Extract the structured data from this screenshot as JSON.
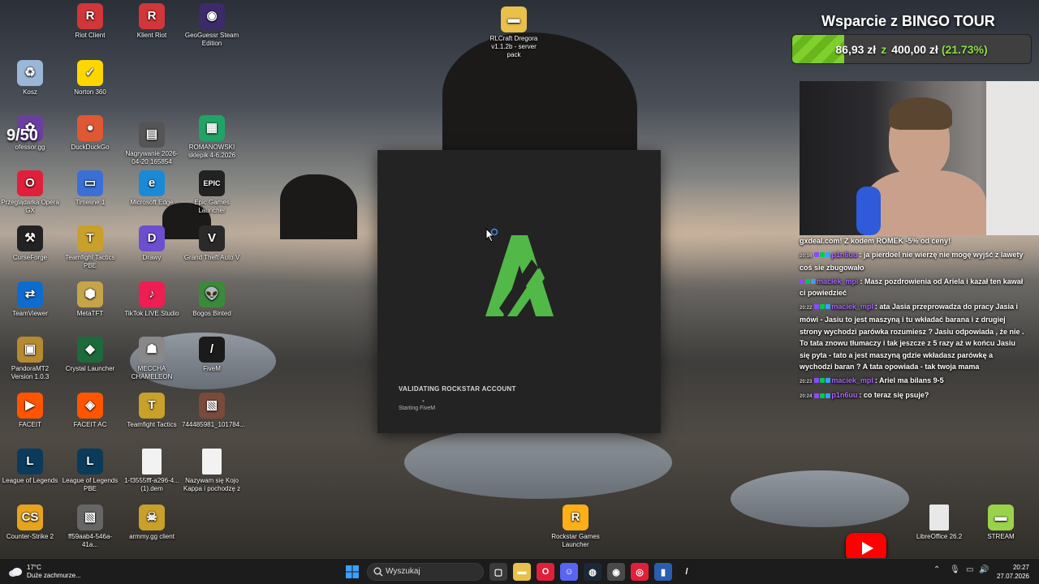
{
  "desktop": {
    "icons": [
      {
        "label": "Riot Client",
        "icon": "riot-icon",
        "color": "#d13639",
        "glyph": "R"
      },
      {
        "label": "Klient Riot",
        "icon": "riot-icon",
        "color": "#d13639",
        "glyph": "R"
      },
      {
        "label": "GeoGuessr Steam Edition",
        "icon": "geoguessr-icon",
        "color": "#3d2a6b",
        "glyph": "◉"
      },
      {
        "label": "RLCraft Dregora v1.1.2b - server pack",
        "icon": "folder-icon",
        "color": "#e8c04a",
        "glyph": "▬"
      },
      {
        "label": "Kosz",
        "icon": "recycle-bin-icon",
        "color": "#9ab7d8",
        "glyph": "♻"
      },
      {
        "label": "Norton 360",
        "icon": "norton-icon",
        "color": "#ffd700",
        "glyph": "✓"
      },
      {
        "label": "ofessor.gg",
        "icon": "professor-icon",
        "color": "#6b3fa0",
        "glyph": "✿"
      },
      {
        "label": "DuckDuckGo",
        "icon": "duckduckgo-icon",
        "color": "#de5833",
        "glyph": "●"
      },
      {
        "label": "Nagrywanie 2026-04-20 165854",
        "icon": "video-icon",
        "color": "#555555",
        "glyph": "▤"
      },
      {
        "label": "ROMANOWSKI sklepik 4-6.2026",
        "icon": "spreadsheet-icon",
        "color": "#21a366",
        "glyph": "▦"
      },
      {
        "label": "Przeglądarka Opera GX",
        "icon": "opera-gx-icon",
        "color": "#e0203a",
        "glyph": "O"
      },
      {
        "label": "Timeline 1",
        "icon": "timeline-icon",
        "color": "#3a6fd8",
        "glyph": "▭"
      },
      {
        "label": "Microsoft Edge",
        "icon": "edge-icon",
        "color": "#1a8ad6",
        "glyph": "e"
      },
      {
        "label": "Epic Games Launcher",
        "icon": "epic-games-icon",
        "color": "#222222",
        "glyph": "EPIC"
      },
      {
        "label": "CurseForge",
        "icon": "curseforge-icon",
        "color": "#222222",
        "glyph": "⚒"
      },
      {
        "label": "Teamfight Tactics PBE",
        "icon": "tft-icon",
        "color": "#c8a02a",
        "glyph": "T"
      },
      {
        "label": "Drawy",
        "icon": "drawy-icon",
        "color": "#6b4fd0",
        "glyph": "D"
      },
      {
        "label": "Grand Theft Auto V",
        "icon": "gta-icon",
        "color": "#2a2a2a",
        "glyph": "V"
      },
      {
        "label": "TeamViewer",
        "icon": "teamviewer-icon",
        "color": "#0e6ccf",
        "glyph": "⇄"
      },
      {
        "label": "MetaTFT",
        "icon": "metatft-icon",
        "color": "#c6a44a",
        "glyph": "⬢"
      },
      {
        "label": "TikTok LIVE Studio",
        "icon": "tiktok-icon",
        "color": "#ee1d52",
        "glyph": "♪"
      },
      {
        "label": "Bogos Binted",
        "icon": "alien-icon",
        "color": "#3a8a3a",
        "glyph": "👽"
      },
      {
        "label": "PandoraMT2 Version 1.0.3",
        "icon": "pandora-icon",
        "color": "#b58a30",
        "glyph": "▣"
      },
      {
        "label": "Crystal Launcher",
        "icon": "crystal-launcher-icon",
        "color": "#1d6b3a",
        "glyph": "◆"
      },
      {
        "label": "MECCHA CHAMELEON",
        "icon": "chameleon-icon",
        "color": "#888888",
        "glyph": "☗"
      },
      {
        "label": "FiveM",
        "icon": "fivem-icon",
        "color": "#1b1b1b",
        "glyph": "/"
      },
      {
        "label": "FACEIT",
        "icon": "faceit-icon",
        "color": "#ff5500",
        "glyph": "▶"
      },
      {
        "label": "FACEIT AC",
        "icon": "faceit-ac-icon",
        "color": "#ff5500",
        "glyph": "◈"
      },
      {
        "label": "Teamfight Tactics",
        "icon": "tft-icon",
        "color": "#c8a02a",
        "glyph": "T"
      },
      {
        "label": "744485981_101784...",
        "icon": "image-icon",
        "color": "#7a4a3a",
        "glyph": "▧"
      },
      {
        "label": "League of Legends",
        "icon": "lol-icon",
        "color": "#0a3b5a",
        "glyph": "L"
      },
      {
        "label": "League of Legends PBE",
        "icon": "lol-icon",
        "color": "#0a3b5a",
        "glyph": "L"
      },
      {
        "label": "1-f3555fff-a296-4... (1).dem",
        "icon": "file-icon",
        "color": "#f2f2f2",
        "glyph": ""
      },
      {
        "label": "Nazywam się Kojo Kappa i pochodzę z",
        "icon": "file-icon",
        "color": "#f2f2f2",
        "glyph": ""
      },
      {
        "label": "Counter-Strike 2",
        "icon": "cs2-icon",
        "color": "#e6a31e",
        "glyph": "CS"
      },
      {
        "label": "ff59aab4-546a-41a...",
        "icon": "image-icon",
        "color": "#666666",
        "glyph": "▧"
      },
      {
        "label": "armmy.gg client",
        "icon": "armmy-icon",
        "color": "#c8a02a",
        "glyph": "☠"
      },
      {
        "label": "Rockstar Games Launcher",
        "icon": "rockstar-icon",
        "color": "#fcaf17",
        "glyph": "R"
      },
      {
        "label": "LibreOffice 26.2",
        "icon": "libreoffice-icon",
        "color": "#e8e8e8",
        "glyph": ""
      },
      {
        "label": "STREAM",
        "icon": "folder-icon",
        "color": "#9ad34a",
        "glyph": "▬"
      }
    ],
    "round_counter": "9/50"
  },
  "fivem_window": {
    "status": "VALIDATING ROCKSTAR ACCOUNT",
    "dot": "•",
    "substatus": "Starting FiveM",
    "accent": "#52b848"
  },
  "overlay": {
    "title": "Wsparcie z BINGO TOUR",
    "current": "86,93 zł",
    "connector": "z",
    "goal": "400,00 zł",
    "percent_label": "(21.73%)",
    "progress": 0.2173,
    "accent": "#7fcf2d"
  },
  "chat": {
    "messages": [
      {
        "time": "",
        "user": "",
        "user_color": "#ffffff",
        "text": "gxdeal.com! Z kodem ROMEK -5% od ceny!"
      },
      {
        "time": "20:16",
        "user": "p1n6uu",
        "user_color": "#b066ff",
        "text": ": ja pierdoel nie wierzę nie mogę wyjść z lawety coś sie zbugowało"
      },
      {
        "time": "",
        "user": "maciek_mpl",
        "user_color": "#a566ff",
        "text": ": Masz pozdrowienia od Ariela i kazał ten kawał ci powiedzieć"
      },
      {
        "time": "20:22",
        "user": "maciek_mpl",
        "user_color": "#a566ff",
        "text": ": ata Jasia przeprowadza do pracy Jasia i mówi - Jasiu to jest maszyną i tu wkładać barana i z drugiej strony wychodzi parówka rozumiesz ? Jasiu odpowiada , że nie . To tata znowu tłumaczy i tak jeszcze z 5 razy aż w końcu Jasiu się pyta - tato a jest maszyną gdzie wkładasz parówkę a wychodzi baran ? A tata opowiada - tak twoja mama"
      },
      {
        "time": "20:23",
        "user": "maciek_mpl",
        "user_color": "#a566ff",
        "text": ": Ariel ma bilans 9-5"
      },
      {
        "time": "20:24",
        "user": "p1n6uu",
        "user_color": "#b066ff",
        "text": ": co teraz się psuje?"
      }
    ]
  },
  "taskbar": {
    "weather_temp": "17°C",
    "weather_desc": "Duże zachmurze...",
    "search_placeholder": "Wyszukaj",
    "time": "20:27",
    "date": "27.07.2026",
    "apps": [
      {
        "name": "file-explorer-icon",
        "color": "#3a3a3a",
        "glyph": "▢"
      },
      {
        "name": "folder-icon",
        "color": "#e8c04a",
        "glyph": "▬"
      },
      {
        "name": "opera-gx-icon",
        "color": "#e0203a",
        "glyph": "O"
      },
      {
        "name": "discord-icon",
        "color": "#5865f2",
        "glyph": "☺"
      },
      {
        "name": "steam-icon",
        "color": "#1b2838",
        "glyph": "◍"
      },
      {
        "name": "chrome-icon",
        "color": "#4a4a4a",
        "glyph": "◉"
      },
      {
        "name": "streamlabs-icon",
        "color": "#e0203a",
        "glyph": "◎"
      },
      {
        "name": "audio-app-icon",
        "color": "#2a5db0",
        "glyph": "▮"
      },
      {
        "name": "fivem-icon",
        "color": "#1b1b1b",
        "glyph": "/"
      }
    ]
  }
}
